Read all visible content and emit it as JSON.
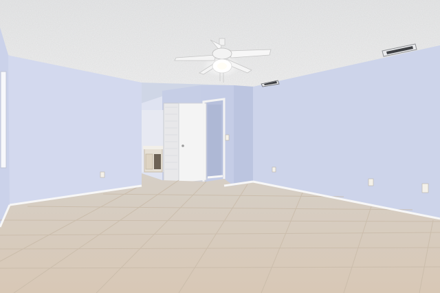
{
  "scene": {
    "colors": {
      "ceiling": "#eceded",
      "wall_left": "#d3d9ee",
      "wall_right": "#cfd6ea",
      "wall_back": "#c9d1e7",
      "floor": "#d9ccbd",
      "baseboard": "#f6f6f6",
      "door": "#f4f4f4"
    }
  }
}
